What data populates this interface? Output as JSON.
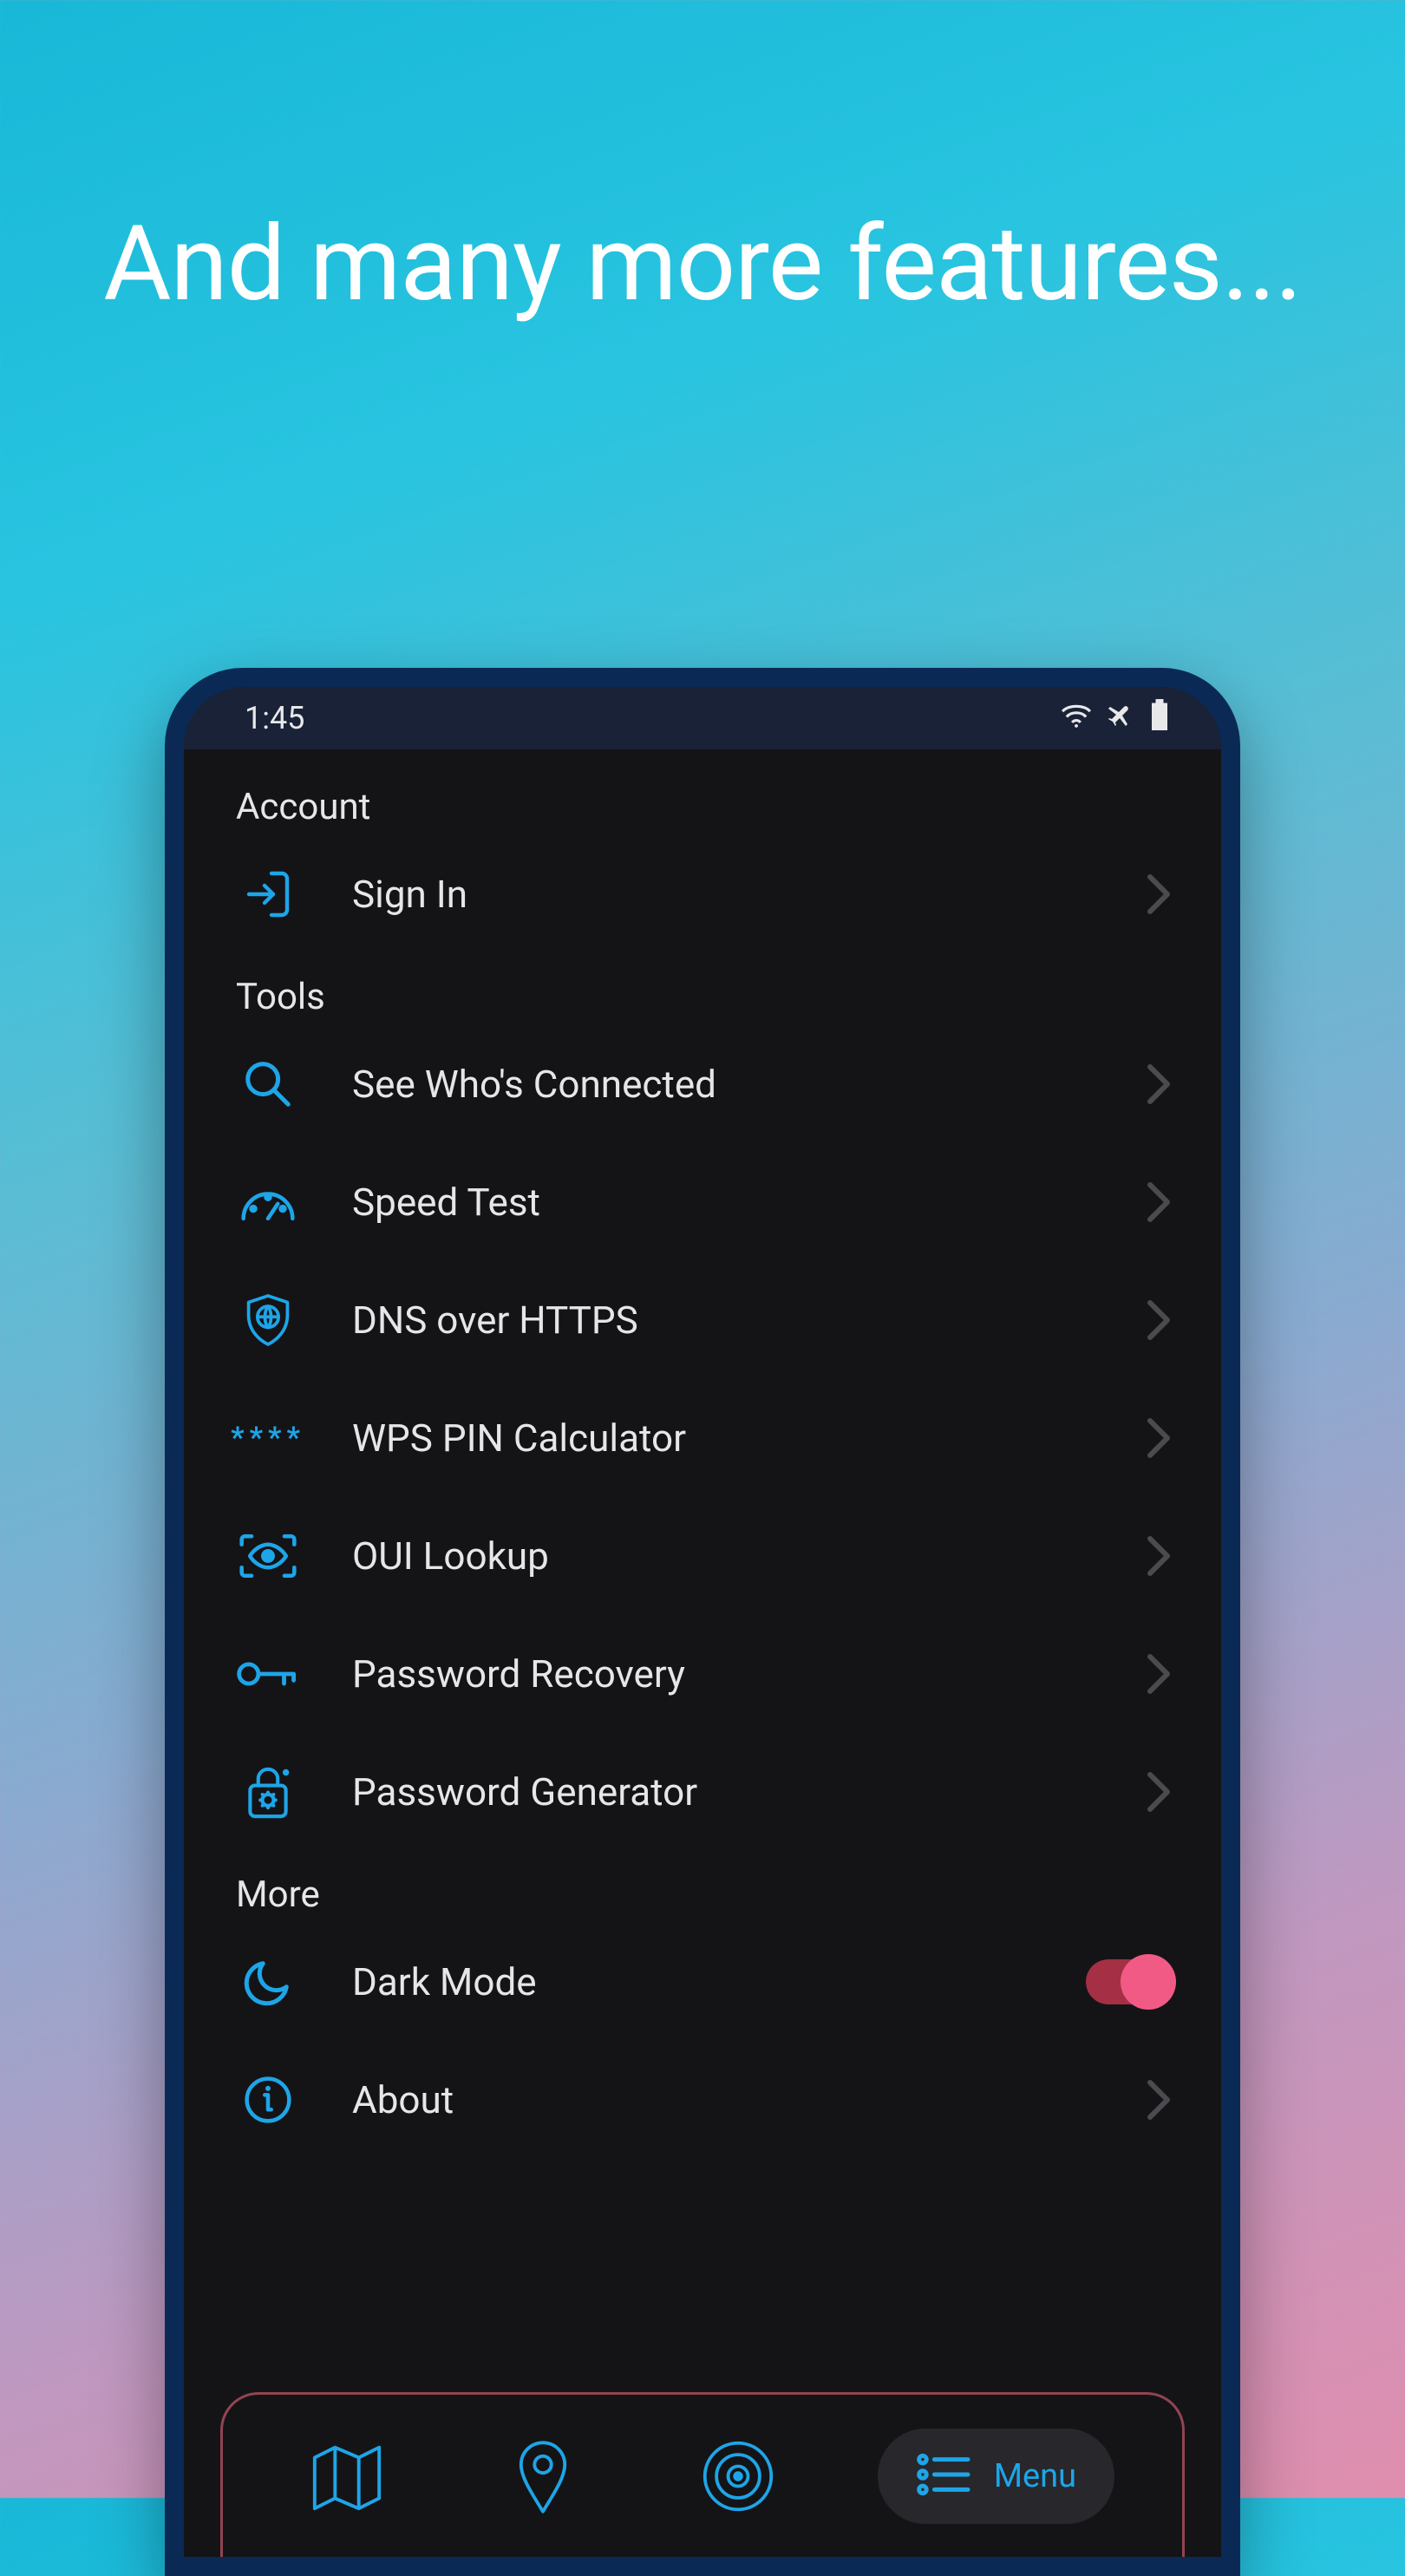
{
  "headline": "And many more features...",
  "status": {
    "time": "1:45"
  },
  "sections": {
    "account": {
      "title": "Account",
      "items": {
        "sign_in": "Sign In"
      }
    },
    "tools": {
      "title": "Tools",
      "items": {
        "see_who": "See Who's Connected",
        "speed_test": "Speed Test",
        "dns": "DNS over HTTPS",
        "wps": "WPS PIN Calculator",
        "oui": "OUI Lookup",
        "pw_recovery": "Password Recovery",
        "pw_generator": "Password Generator"
      }
    },
    "more": {
      "title": "More",
      "items": {
        "dark_mode": "Dark Mode",
        "about": "About"
      },
      "dark_mode_on": true
    }
  },
  "nav": {
    "menu_label": "Menu"
  }
}
